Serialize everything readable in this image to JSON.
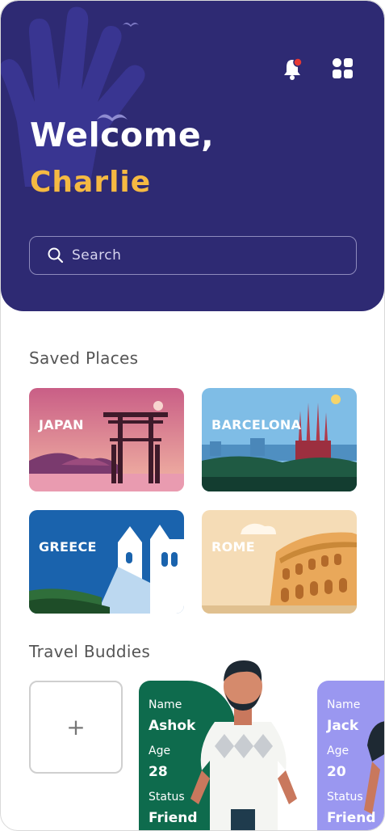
{
  "header": {
    "greeting": "Welcome,",
    "user_name": "Charlie",
    "notification_icon": "bell-icon",
    "menu_icon": "grid-icon",
    "notification_dot_color": "#e53935",
    "background_color": "#2e2a73",
    "accent_color": "#f5b942"
  },
  "search": {
    "placeholder": "Search",
    "icon": "search-icon"
  },
  "saved_places": {
    "title": "Saved Places",
    "items": [
      {
        "label": "JAPAN"
      },
      {
        "label": "BARCELONA"
      },
      {
        "label": "GREECE"
      },
      {
        "label": "ROME"
      }
    ]
  },
  "travel_buddies": {
    "title": "Travel Buddies",
    "add_label": "+",
    "items": [
      {
        "name_label": "Name",
        "name": "Ashok",
        "age_label": "Age",
        "age": "28",
        "status_label": "Status",
        "status": "Friend",
        "color": "#0e6b4d"
      },
      {
        "name_label": "Name",
        "name": "Jack",
        "age_label": "Age",
        "age": "20",
        "status_label": "Status",
        "status": "Friend",
        "color": "#9a97f0"
      }
    ]
  }
}
